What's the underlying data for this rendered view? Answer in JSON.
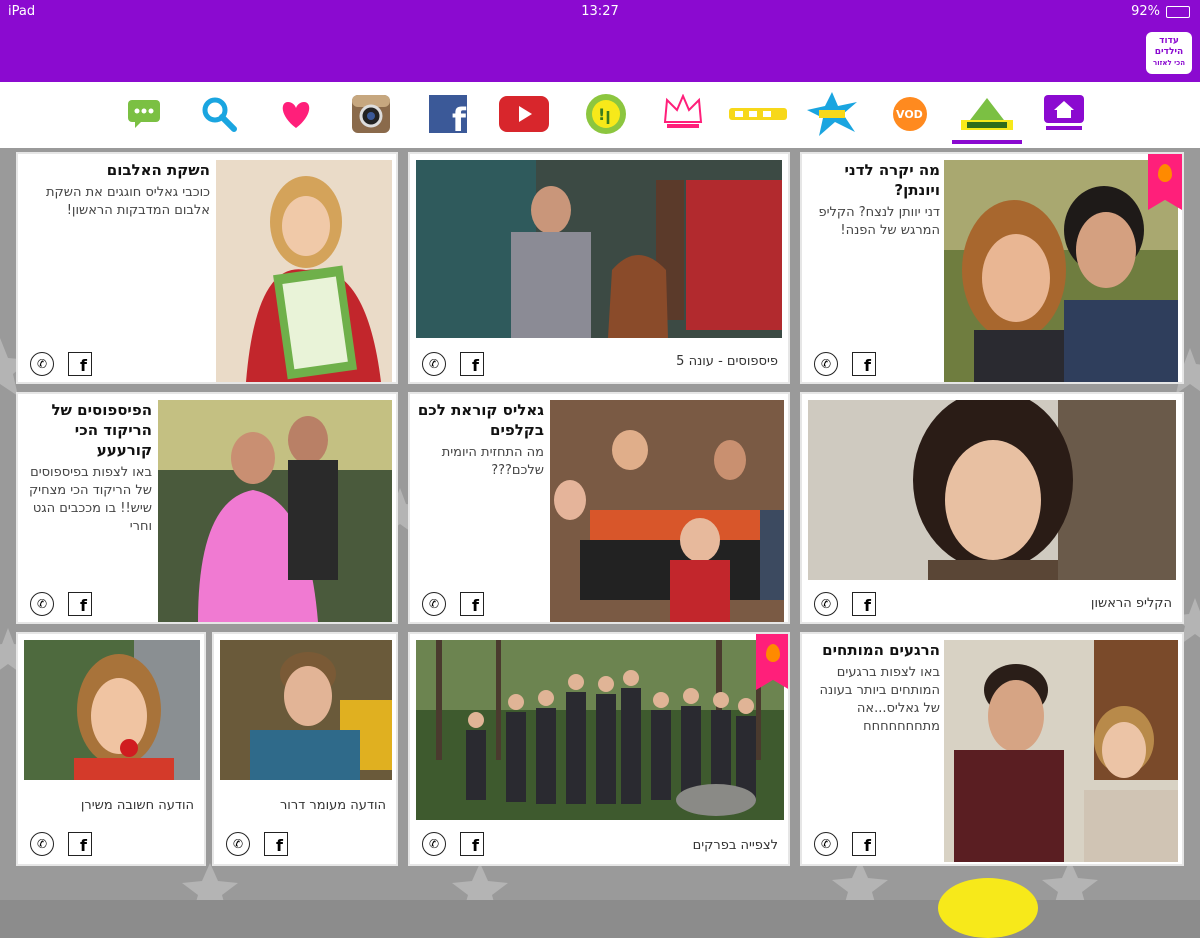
{
  "status_bar": {
    "device": "iPad",
    "time": "13:27",
    "battery": "92%"
  },
  "app_logo": {
    "line1": "עדוד",
    "line2": "הילדים",
    "line3": "הכי לאזור"
  },
  "toolbar": {
    "items": [
      {
        "name": "chat-icon",
        "label": ""
      },
      {
        "name": "search-icon",
        "label": ""
      },
      {
        "name": "heart-icon",
        "label": ""
      },
      {
        "name": "instagram-icon",
        "label": ""
      },
      {
        "name": "facebook-icon",
        "label": ""
      },
      {
        "name": "youtube-icon",
        "label": ""
      },
      {
        "name": "channel-logo-1",
        "label": ""
      },
      {
        "name": "crown-icon",
        "label": ""
      },
      {
        "name": "yellow-logo",
        "label": ""
      },
      {
        "name": "splash-logo",
        "label": ""
      },
      {
        "name": "vod-icon",
        "label": "VOD"
      },
      {
        "name": "galis-logo",
        "label": ""
      },
      {
        "name": "home-icon",
        "label": ""
      }
    ],
    "colors": {
      "accent": "#8b0ad0",
      "pink": "#ff1f7a",
      "youtube": "#d8262c",
      "facebook": "#3b5998"
    }
  },
  "cards": [
    {
      "title": "השקת האלבום",
      "desc": "כוכבי גאליס חוגגים את השקת אלבום המדבקות הראשון!",
      "caption": ""
    },
    {
      "title": "",
      "desc": "",
      "caption": "פיספוסים - עונה 5"
    },
    {
      "title": "מה יקרה לדני ויונתן?",
      "desc": "דני יוותן לנצח? הקליפ המרגש של הפנה!",
      "caption": ""
    },
    {
      "title": "הפיספוסים של הריקוד הכי קורעעע",
      "desc": "באו לצפות בפיספוסים של הריקוד הכי מצחיק שיש!! בו מככבים הגט וחרי",
      "caption": ""
    },
    {
      "title": "גאליס קוראת לכם בקלפים",
      "desc": "מה התחזית היומית שלכם???",
      "caption": ""
    },
    {
      "title": "",
      "desc": "",
      "caption": "הקליפ הראשון"
    },
    {
      "title": "",
      "desc": "",
      "caption": "הודעה חשובה משירן"
    },
    {
      "title": "",
      "desc": "",
      "caption": "הודעה מעומר דרור"
    },
    {
      "title": "",
      "desc": "",
      "caption": "לצפייה בפרקים"
    },
    {
      "title": "הרגעים המותחים",
      "desc": "באו לצפות ברגעים המותחים ביותר בעונה של גאליס...אה מתחחחחחחח",
      "caption": ""
    }
  ]
}
